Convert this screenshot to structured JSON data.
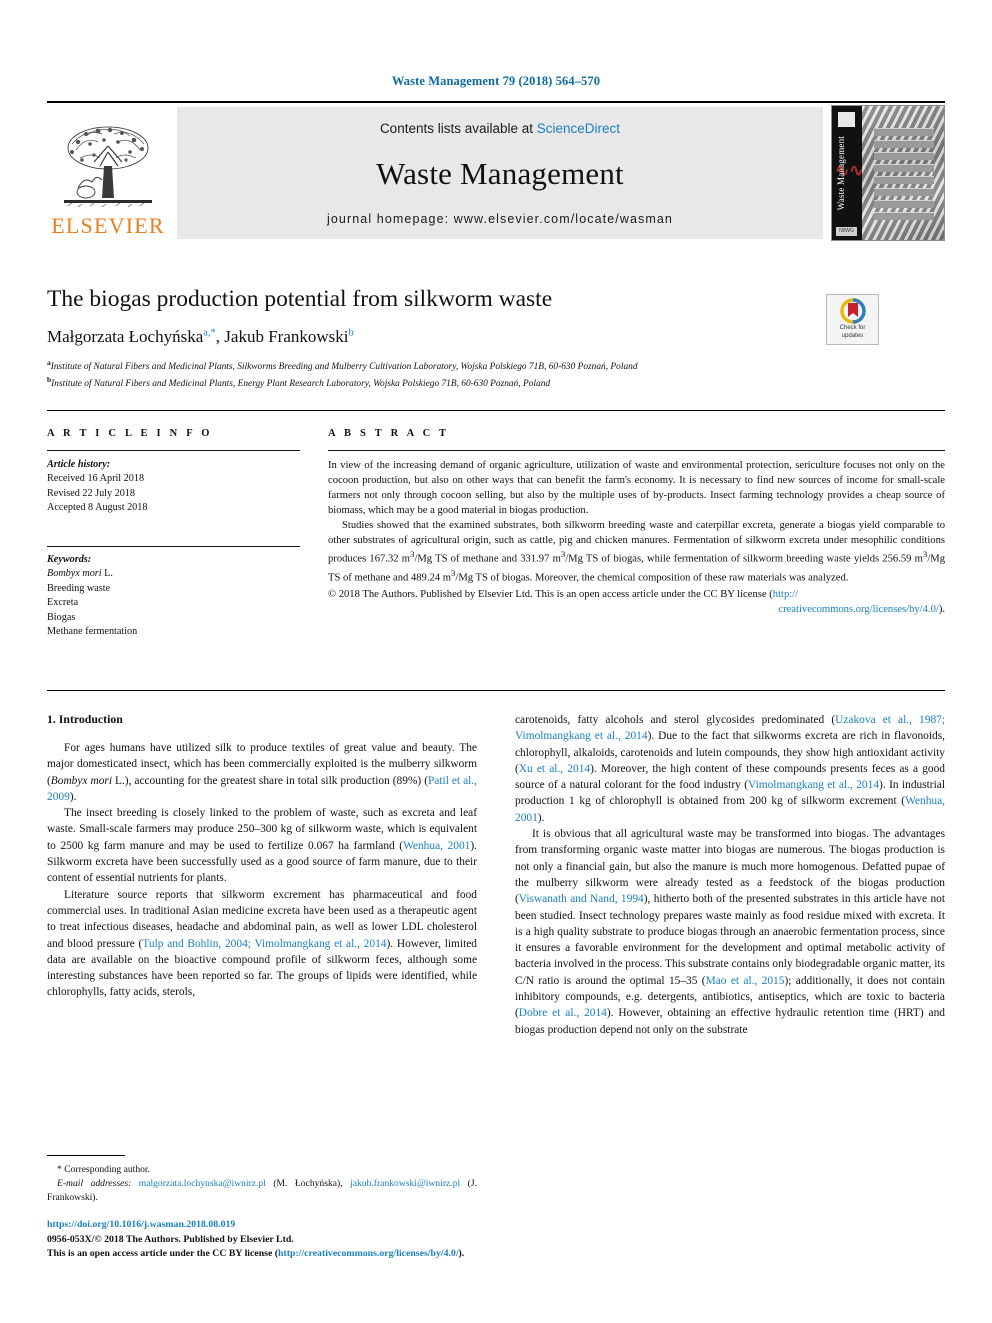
{
  "running_head": "Waste Management 79 (2018) 564–570",
  "masthead": {
    "publisher_name": "ELSEVIER",
    "publisher_logo_icon": "elsevier-tree-icon",
    "contents_prefix": "Contents lists available at ",
    "contents_link": "ScienceDirect",
    "journal_name": "Waste Management",
    "homepage": "journal homepage: www.elsevier.com/locate/wasman",
    "cover": {
      "vertical_title": "Waste Management",
      "logo_label": "ELSEVIER",
      "bottom_label": "IWWG"
    }
  },
  "crossmark": {
    "line1": "Check for",
    "line2": "updates",
    "icon": "crossmark-badge-icon"
  },
  "article": {
    "title": "The biogas production potential from silkworm waste",
    "authors": [
      {
        "name": "Małgorzata Łochyńska",
        "marks": "a,*"
      },
      {
        "name": "Jakub Frankowski",
        "marks": "b"
      }
    ],
    "authors_line_a_name": "Małgorzata Łochyńska",
    "authors_line_a_marks": "a,*",
    "authors_line_b_name": ", Jakub Frankowski",
    "authors_line_b_marks": "b",
    "affiliations": [
      {
        "mark": "a",
        "text": "Institute of Natural Fibers and Medicinal Plants, Silkworms Breeding and Mulberry Cultivation Laboratory, Wojska Polskiego 71B, 60-630 Poznań, Poland"
      },
      {
        "mark": "b",
        "text": "Institute of Natural Fibers and Medicinal Plants, Energy Plant Research Laboratory, Wojska Polskiego 71B, 60-630 Poznań, Poland"
      }
    ]
  },
  "article_info": {
    "heading": "A R T I C L E   I N F O",
    "history_label": "Article history:",
    "history": [
      "Received 16 April 2018",
      "Revised 22 July 2018",
      "Accepted 8 August 2018"
    ],
    "keywords_label": "Keywords:",
    "keywords": [
      "Bombyx mori L.",
      "Breeding waste",
      "Excreta",
      "Biogas",
      "Methane fermentation"
    ],
    "keyword_italic_first": "Bombyx mori",
    "keyword_italic_first_suffix": " L."
  },
  "abstract": {
    "heading": "A B S T R A C T",
    "paragraph1": "In view of the increasing demand of organic agriculture, utilization of waste and environmental protection, sericulture focuses not only on the cocoon production, but also on other ways that can benefit the farm's economy. It is necessary to find new sources of income for small-scale farmers not only through cocoon selling, but also by the multiple uses of by-products. Insect farming technology provides a cheap source of biomass, which may be a good material in biogas production.",
    "paragraph2_pre": "Studies showed that the examined substrates, both silkworm breeding waste and caterpillar excreta, generate a biogas yield comparable to other substrates of agricultural origin, such as cattle, pig and chicken manures. Fermentation of silkworm excreta under mesophilic conditions produces 167.32 m",
    "paragraph2_mid": "/Mg TS of methane and 331.97 m",
    "paragraph2_mid2": "/Mg TS of biogas, while fermentation of silkworm breeding waste yields 256.59 m",
    "paragraph2_mid3": "/Mg TS of methane and 489.24 m",
    "paragraph2_end": "/Mg TS of biogas. Moreover, the chemical composition of these raw materials was analyzed.",
    "superscript": "3",
    "copyright_text": "© 2018 The Authors. Published by Elsevier Ltd. This is an open access article under the CC BY license (",
    "license_url_part1": "http://",
    "license_url_part2": "creativecommons.org/licenses/by/4.0/",
    "license_close": ")."
  },
  "body": {
    "section1_title": "1. Introduction",
    "left_paragraphs": [
      {
        "segments": [
          {
            "t": "For ages humans have utilized silk to produce textiles of great value and beauty. The major domesticated insect, which has been commercially exploited is the mulberry silkworm (",
            "k": "plain"
          },
          {
            "t": "Bombyx mori",
            "k": "ital"
          },
          {
            "t": " L.), accounting for the greatest share in total silk production (89%) (",
            "k": "plain"
          },
          {
            "t": "Patil et al., 2009",
            "k": "link"
          },
          {
            "t": ").",
            "k": "plain"
          }
        ]
      },
      {
        "segments": [
          {
            "t": "The insect breeding is closely linked to the problem of waste, such as excreta and leaf waste. Small-scale farmers may produce 250–300 kg of silkworm waste, which is equivalent to 2500 kg farm manure and may be used to fertilize 0.067 ha farmland (",
            "k": "plain"
          },
          {
            "t": "Wenhua, 2001",
            "k": "link"
          },
          {
            "t": "). Silkworm excreta have been successfully used as a good source of farm manure, due to their content of essential nutrients for plants.",
            "k": "plain"
          }
        ]
      },
      {
        "segments": [
          {
            "t": "Literature source reports that silkworm excrement has pharmaceutical and food commercial uses. In traditional Asian medicine excreta have been used as a therapeutic agent to treat infectious diseases, headache and abdominal pain, as well as lower LDL cholesterol and blood pressure (",
            "k": "plain"
          },
          {
            "t": "Tulp and Bohlin, 2004; Vimolmangkang et al., 2014",
            "k": "link"
          },
          {
            "t": "). However, limited data are available on the bioactive compound profile of silkworm feces, although some interesting substances have been reported so far. The groups of lipids were identified, while chlorophylls, fatty acids, sterols,",
            "k": "plain"
          }
        ]
      }
    ],
    "right_paragraphs": [
      {
        "indent": false,
        "segments": [
          {
            "t": "carotenoids, fatty alcohols and sterol glycosides predominated (",
            "k": "plain"
          },
          {
            "t": "Uzakova et al., 1987; Vimolmangkang et al., 2014",
            "k": "link"
          },
          {
            "t": "). Due to the fact that silkworms excreta are rich in flavonoids, chlorophyll, alkaloids, carotenoids and lutein compounds, they show high antioxidant activity (",
            "k": "plain"
          },
          {
            "t": "Xu et al., 2014",
            "k": "link"
          },
          {
            "t": "). Moreover, the high content of these compounds presents feces as a good source of a natural colorant for the food industry (",
            "k": "plain"
          },
          {
            "t": "Vimolmangkang et al., 2014",
            "k": "link"
          },
          {
            "t": "). In industrial production 1 kg of chlorophyll is obtained from 200 kg of silkworm excrement (",
            "k": "plain"
          },
          {
            "t": "Wenhua, 2001",
            "k": "link"
          },
          {
            "t": ").",
            "k": "plain"
          }
        ]
      },
      {
        "indent": true,
        "segments": [
          {
            "t": "It is obvious that all agricultural waste may be transformed into biogas. The advantages from transforming organic waste matter into biogas are numerous. The biogas production is not only a financial gain, but also the manure is much more homogenous. Defatted pupae of the mulberry silkworm were already tested as a feedstock of the biogas production (",
            "k": "plain"
          },
          {
            "t": "Viswanath and Nand, 1994",
            "k": "link"
          },
          {
            "t": "), hitherto both of the presented substrates in this article have not been studied. Insect technology prepares waste mainly as food residue mixed with excreta. It is a high quality substrate to produce biogas through an anaerobic fermentation process, since it ensures a favorable environment for the development and optimal metabolic activity of bacteria involved in the process. This substrate contains only biodegradable organic matter, its C/N ratio is around the optimal 15–35 (",
            "k": "plain"
          },
          {
            "t": "Mao et al., 2015",
            "k": "link"
          },
          {
            "t": "); additionally, it does not contain inhibitory compounds, e.g. detergents, antibiotics, antiseptics, which are toxic to bacteria (",
            "k": "plain"
          },
          {
            "t": "Dobre et al., 2014",
            "k": "link"
          },
          {
            "t": "). However, obtaining an effective hydraulic retention time (HRT) and biogas production depend not only on the substrate",
            "k": "plain"
          }
        ]
      }
    ]
  },
  "footnote": {
    "corresponding": "* Corresponding author.",
    "email_label": "E-mail addresses:",
    "email1": "malgorzata.lochynska@iwnirz.pl",
    "email1_suffix": " (M. Łochyńska), ",
    "email2": "jakub.frankowski@iwnirz.pl",
    "email2_suffix": " (J. Frankowski)."
  },
  "page_footer": {
    "doi": "https://doi.org/10.1016/j.wasman.2018.08.019",
    "issn_line": "0956-053X/© 2018 The Authors. Published by Elsevier Ltd.",
    "license_pre": "This is an open access article under the CC BY license (",
    "license_url": "http://creativecommons.org/licenses/by/4.0/",
    "license_post": ")."
  },
  "colors": {
    "link": "#1a7fc1",
    "running_head": "#0b6ba0",
    "elsevier_orange": "#ef7d1a",
    "masthead_bg": "#e8e8e8"
  }
}
